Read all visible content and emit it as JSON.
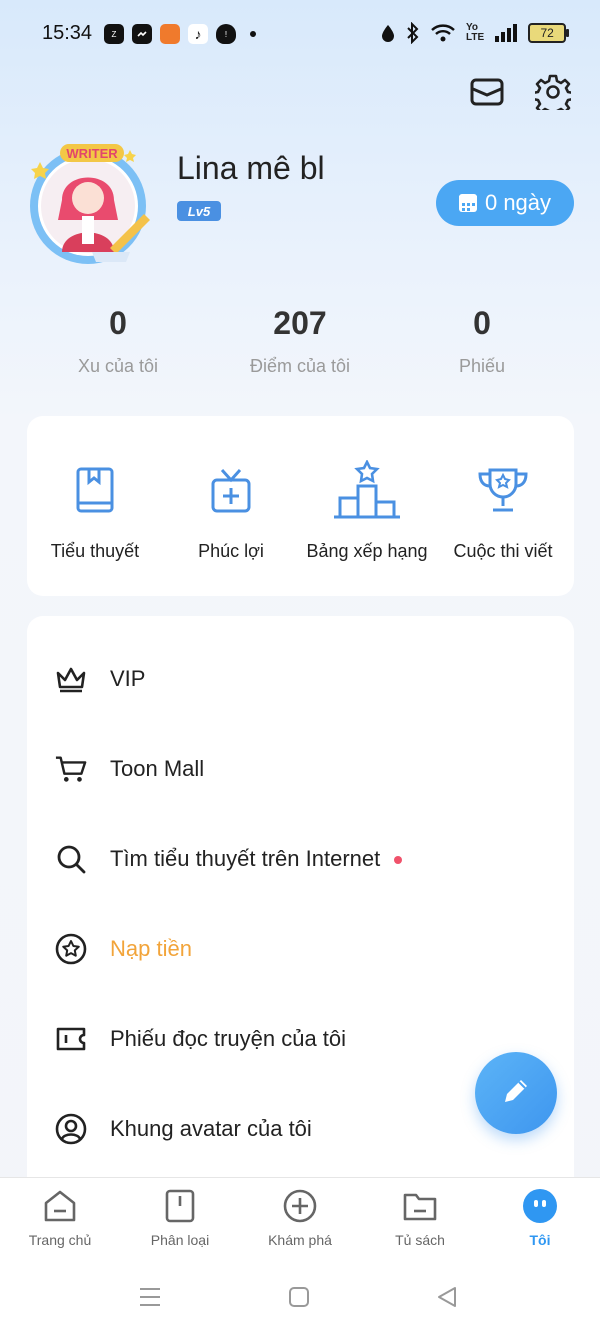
{
  "status_bar": {
    "time": "15:34",
    "battery": "72",
    "app_icons": [
      "zalo-icon",
      "messenger-icon",
      "game-icon",
      "tiktok-icon",
      "shield-icon"
    ]
  },
  "profile": {
    "username": "Lina mê bl",
    "level": "Lv5",
    "avatar_frame_text": "WRITER",
    "checkin_label": "0 ngày"
  },
  "stats": [
    {
      "value": "0",
      "label": "Xu của tôi"
    },
    {
      "value": "207",
      "label": "Điểm của tôi"
    },
    {
      "value": "0",
      "label": "Phiếu"
    }
  ],
  "features": [
    {
      "label": "Tiểu thuyết",
      "icon": "book-icon"
    },
    {
      "label": "Phúc lợi",
      "icon": "gift-icon"
    },
    {
      "label": "Bảng xếp hạng",
      "icon": "podium-icon"
    },
    {
      "label": "Cuộc thi viết",
      "icon": "trophy-icon"
    }
  ],
  "menu": [
    {
      "label": "VIP",
      "icon": "crown-icon"
    },
    {
      "label": "Toon Mall",
      "icon": "cart-icon"
    },
    {
      "label": "Tìm tiểu thuyết trên Internet",
      "icon": "search-icon"
    },
    {
      "label": "Nạp tiền",
      "icon": "star-coin-icon"
    },
    {
      "label": "Phiếu đọc truyện của tôi",
      "icon": "ticket-icon"
    },
    {
      "label": "Khung avatar của tôi",
      "icon": "avatar-frame-icon"
    }
  ],
  "bottom_nav": [
    {
      "label": "Trang chủ",
      "icon": "home-icon"
    },
    {
      "label": "Phân loại",
      "icon": "category-icon"
    },
    {
      "label": "Khám phá",
      "icon": "explore-icon"
    },
    {
      "label": "Tủ sách",
      "icon": "bookshelf-icon"
    },
    {
      "label": "Tôi",
      "icon": "me-icon"
    }
  ],
  "colors": {
    "accent": "#2f97f2",
    "orange": "#f2a43a",
    "notification_dot": "#f0526b"
  }
}
